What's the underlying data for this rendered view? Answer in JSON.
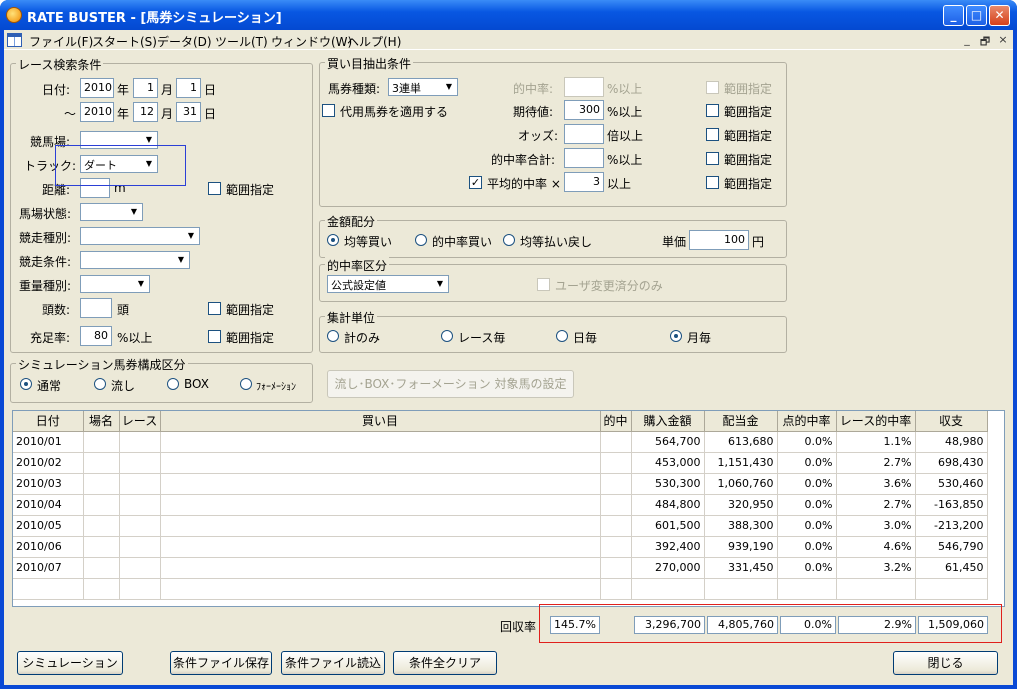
{
  "window": {
    "title": "RATE BUSTER - [馬券シミュレーション]",
    "minimize_label": "_",
    "maximize_label": "□",
    "close_label": "✕"
  },
  "menu": [
    "ファイル(F)",
    "スタート(S)",
    "データ(D)",
    "ツール(T)",
    "ウィンドウ(W)",
    "ヘルプ(H)"
  ],
  "mdi_controls": [
    "_",
    "🗗",
    "×"
  ],
  "race": {
    "group_label": "レース検索条件",
    "date_label": "日付:",
    "from": {
      "year": "2010",
      "month": "1",
      "day": "1"
    },
    "to_prefix": "～",
    "to": {
      "year": "2010",
      "month": "12",
      "day": "31"
    },
    "year_unit": "年",
    "month_unit": "月",
    "day_unit": "日",
    "venue_label": "競馬場:",
    "venue_value": "",
    "track_label": "トラック:",
    "track_value": "ダート",
    "distance_label": "距離:",
    "distance_value": "",
    "distance_unit": "m",
    "range_label": "範囲指定",
    "condition_label": "馬場状態:",
    "type_label": "競走種別:",
    "cond2_label": "競走条件:",
    "weight_label": "重量種別:",
    "heads_label": "頭数:",
    "heads_value": "",
    "heads_unit": "頭",
    "fill_label": "充足率:",
    "fill_value": "80",
    "fill_unit": "%以上"
  },
  "ticket_group": {
    "label": "シミュレーション馬券構成区分",
    "options": [
      "通常",
      "流し",
      "BOX",
      "ﾌｫｰﾒｰｼｮﾝ"
    ],
    "selected": 0
  },
  "bet": {
    "group_label": "買い目抽出条件",
    "type_label": "馬券種類:",
    "type_value": "3連単",
    "substitute_label": "代用馬券を適用する",
    "hit_rate_label": "的中率:",
    "hit_rate_value": "",
    "hit_rate_unit": "%以上",
    "expected_label": "期待値:",
    "expected_value": "300",
    "expected_unit": "%以上",
    "odds_label": "オッズ:",
    "odds_value": "",
    "odds_unit": "倍以上",
    "hit_total_label": "的中率合計:",
    "hit_total_value": "",
    "hit_total_unit": "%以上",
    "avg_label": "平均的中率 ×",
    "avg_value": "3",
    "avg_unit": "以上",
    "range_label": "範囲指定"
  },
  "amount": {
    "group_label": "金額配分",
    "options": [
      "均等買い",
      "的中率買い",
      "均等払い戻し"
    ],
    "selected": 0,
    "unit_label": "単価",
    "unit_value": "100",
    "unit_suffix": "円"
  },
  "hit_class": {
    "group_label": "的中率区分",
    "value": "公式設定値",
    "user_only_label": "ユーザ変更済分のみ"
  },
  "aggregate": {
    "group_label": "集計単位",
    "options": [
      "計のみ",
      "レース毎",
      "日毎",
      "月毎"
    ],
    "selected": 3
  },
  "target_button": "流し･BOX･フォーメーション 対象馬の設定",
  "table": {
    "headers": [
      "日付",
      "場名",
      "レース",
      "買い目",
      "的中",
      "購入金額",
      "配当金",
      "点的中率",
      "レース的中率",
      "収支"
    ],
    "rows": [
      [
        "2010/01",
        "",
        "",
        "",
        "",
        "564,700",
        "613,680",
        "0.0%",
        "1.1%",
        "48,980"
      ],
      [
        "2010/02",
        "",
        "",
        "",
        "",
        "453,000",
        "1,151,430",
        "0.0%",
        "2.7%",
        "698,430"
      ],
      [
        "2010/03",
        "",
        "",
        "",
        "",
        "530,300",
        "1,060,760",
        "0.0%",
        "3.6%",
        "530,460"
      ],
      [
        "2010/04",
        "",
        "",
        "",
        "",
        "484,800",
        "320,950",
        "0.0%",
        "2.7%",
        "-163,850"
      ],
      [
        "2010/05",
        "",
        "",
        "",
        "",
        "601,500",
        "388,300",
        "0.0%",
        "3.0%",
        "-213,200"
      ],
      [
        "2010/06",
        "",
        "",
        "",
        "",
        "392,400",
        "939,190",
        "0.0%",
        "4.6%",
        "546,790"
      ],
      [
        "2010/07",
        "",
        "",
        "",
        "",
        "270,000",
        "331,450",
        "0.0%",
        "3.2%",
        "61,450"
      ]
    ]
  },
  "totals": {
    "return_label": "回収率",
    "return_value": "145.7%",
    "purchase": "3,296,700",
    "payout": "4,805,760",
    "point_rate": "0.0%",
    "race_rate": "2.9%",
    "balance": "1,509,060"
  },
  "buttons": {
    "simulate": "シミュレーション",
    "save": "条件ファイル保存",
    "load": "条件ファイル読込",
    "clear": "条件全クリア",
    "close": "閉じる"
  },
  "highlight_colors": {
    "blue": "#2b3fd6",
    "red": "#e0201c"
  }
}
